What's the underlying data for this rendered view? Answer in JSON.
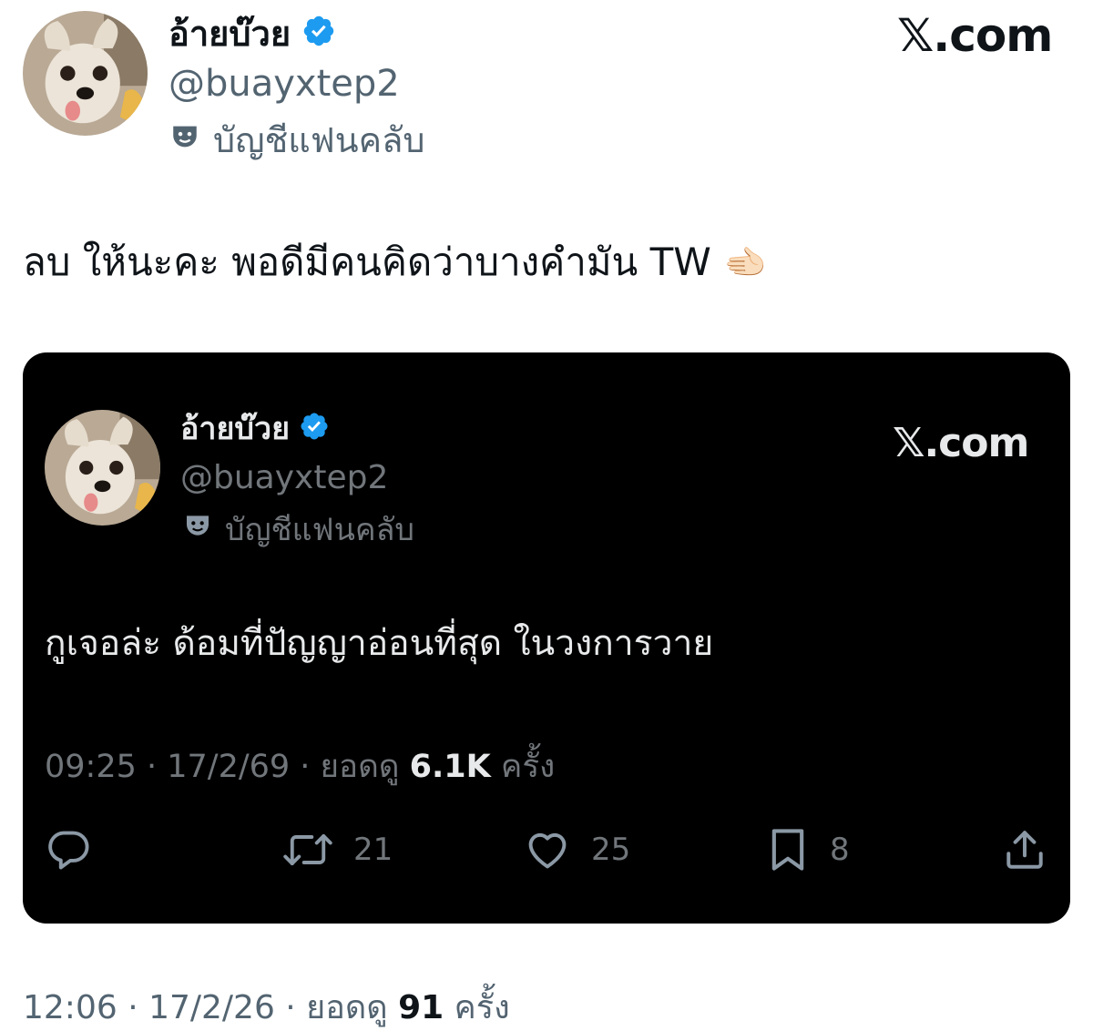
{
  "outer": {
    "display_name": "อ้ายบ๊วย",
    "handle": "@buayxtep2",
    "badge_label": "บัญชีแฟนคลับ",
    "brand": "𝕏.com",
    "text": "ลบ ให้นะคะ พอดีมีคนคิดว่าบางคำมัน TW",
    "emoji": "🫲🏻",
    "meta_time": "12:06 · 17/2/26 · ยอดดู ",
    "meta_views": "91",
    "meta_suffix": " ครั้ง"
  },
  "quoted": {
    "display_name": "อ้ายบ๊วย",
    "handle": "@buayxtep2",
    "badge_label": "บัญชีแฟนคลับ",
    "brand": "𝕏.com",
    "text": "กูเจอล่ะ ด้อมที่ปัญญาอ่อนที่สุด ในวงการวาย",
    "meta_time": "09:25 · 17/2/69 · ยอดดู ",
    "meta_views": "6.1K",
    "meta_suffix": " ครั้ง",
    "actions": {
      "reply": "",
      "retweets": "21",
      "likes": "25",
      "bookmarks": "8"
    }
  },
  "colors": {
    "verified": "#1d9bf0",
    "card_bg": "#000000",
    "muted_light": "#536471",
    "muted_dark": "#71767b"
  },
  "icons": [
    "verified-badge-icon",
    "fan-mask-icon",
    "reply-icon",
    "retweet-icon",
    "like-icon",
    "bookmark-icon",
    "share-icon"
  ]
}
